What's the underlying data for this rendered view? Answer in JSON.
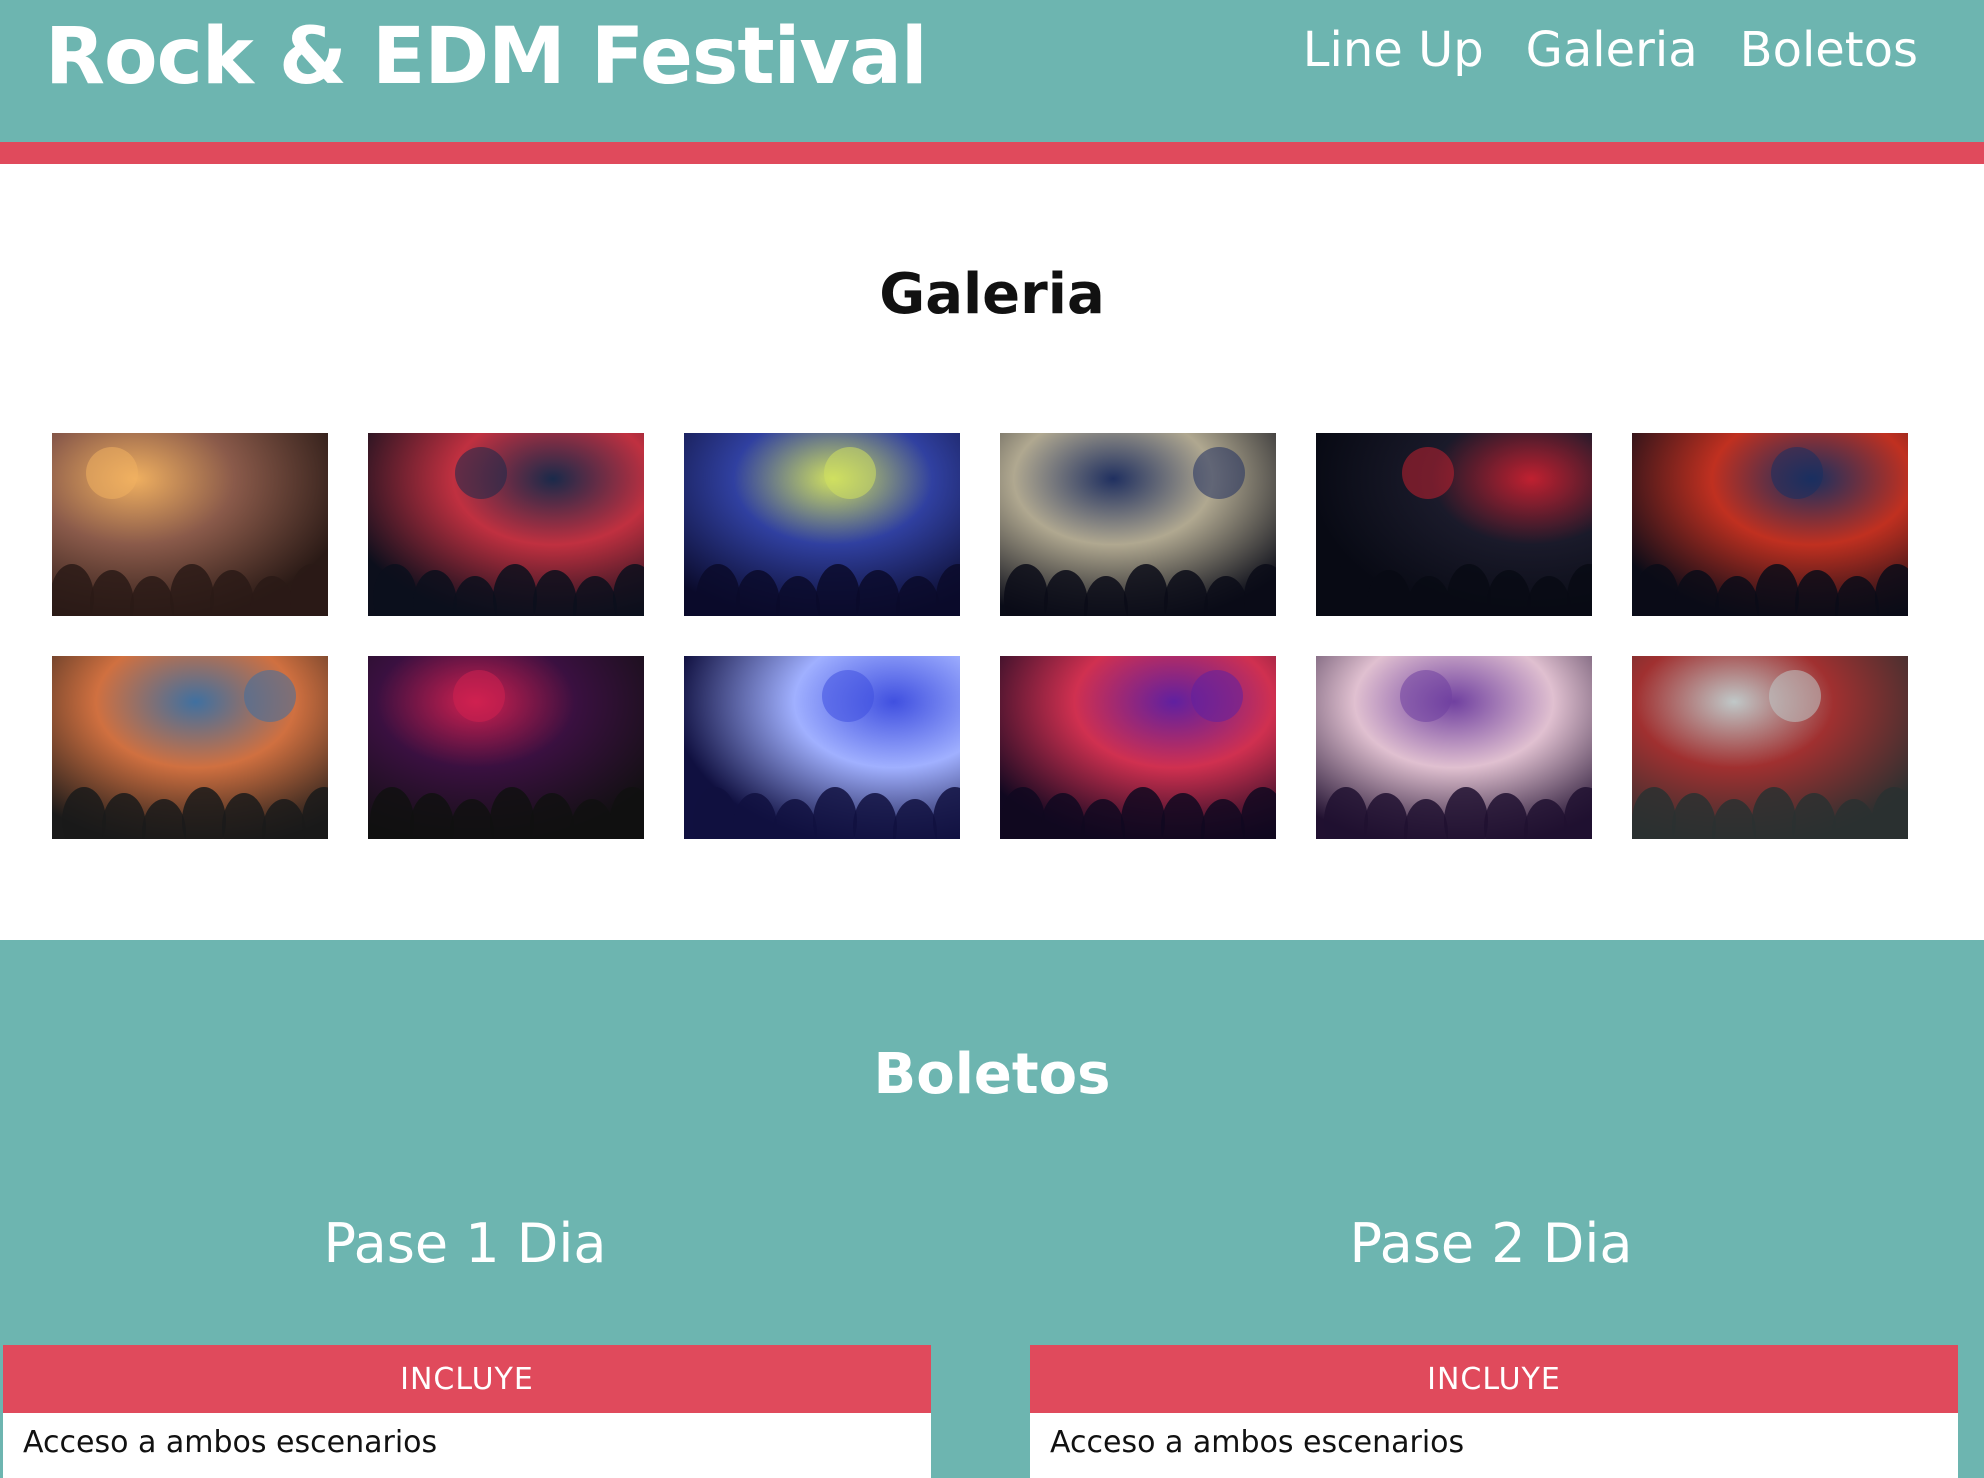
{
  "header": {
    "title": "Rock & EDM Festival",
    "nav": [
      "Line Up",
      "Galeria",
      "Boletos"
    ]
  },
  "gallery": {
    "title": "Galeria",
    "photos": [
      {
        "name": "gallery-photo-crowd-lights",
        "colors": [
          "#f0b060",
          "#8a5a4a",
          "#2a1a16"
        ]
      },
      {
        "name": "gallery-photo-singer-stage",
        "colors": [
          "#1a2a4a",
          "#c03040",
          "#0c0f1c"
        ]
      },
      {
        "name": "gallery-photo-club-lasers",
        "colors": [
          "#d0e060",
          "#3040a0",
          "#0a0a2a"
        ]
      },
      {
        "name": "gallery-photo-dj-turntable",
        "colors": [
          "#203060",
          "#b0a890",
          "#0a0c18"
        ]
      },
      {
        "name": "gallery-photo-guitarist-red",
        "colors": [
          "#c02030",
          "#1a1a2a",
          "#080a14"
        ]
      },
      {
        "name": "gallery-photo-female-dj",
        "colors": [
          "#1a3060",
          "#c03020",
          "#0a0c18"
        ]
      },
      {
        "name": "gallery-photo-guitars-closeup",
        "colors": [
          "#4070a0",
          "#d07040",
          "#1a1a1a"
        ]
      },
      {
        "name": "gallery-photo-dj-laptop",
        "colors": [
          "#d02050",
          "#3a1040",
          "#101010"
        ]
      },
      {
        "name": "gallery-photo-dj-mixer-blue",
        "colors": [
          "#4050e0",
          "#a0b0ff",
          "#101040"
        ]
      },
      {
        "name": "gallery-photo-dj-controller-purple",
        "colors": [
          "#6020a0",
          "#d03050",
          "#100820"
        ]
      },
      {
        "name": "gallery-photo-band-duo",
        "colors": [
          "#7040a0",
          "#e0c0d0",
          "#201030"
        ]
      },
      {
        "name": "gallery-photo-smoke-performer",
        "colors": [
          "#c0c8c8",
          "#a03030",
          "#2a3030"
        ]
      }
    ]
  },
  "tickets": {
    "title": "Boletos",
    "passes": [
      {
        "name": "Pase 1 Dia",
        "includes_label": "INCLUYE",
        "items": [
          "Acceso a ambos escenarios"
        ]
      },
      {
        "name": "Pase 2 Dia",
        "includes_label": "INCLUYE",
        "items": [
          "Acceso a ambos escenarios"
        ]
      }
    ]
  },
  "colors": {
    "teal": "#6db5b0",
    "accent_red": "#e04a5c",
    "white": "#ffffff"
  }
}
